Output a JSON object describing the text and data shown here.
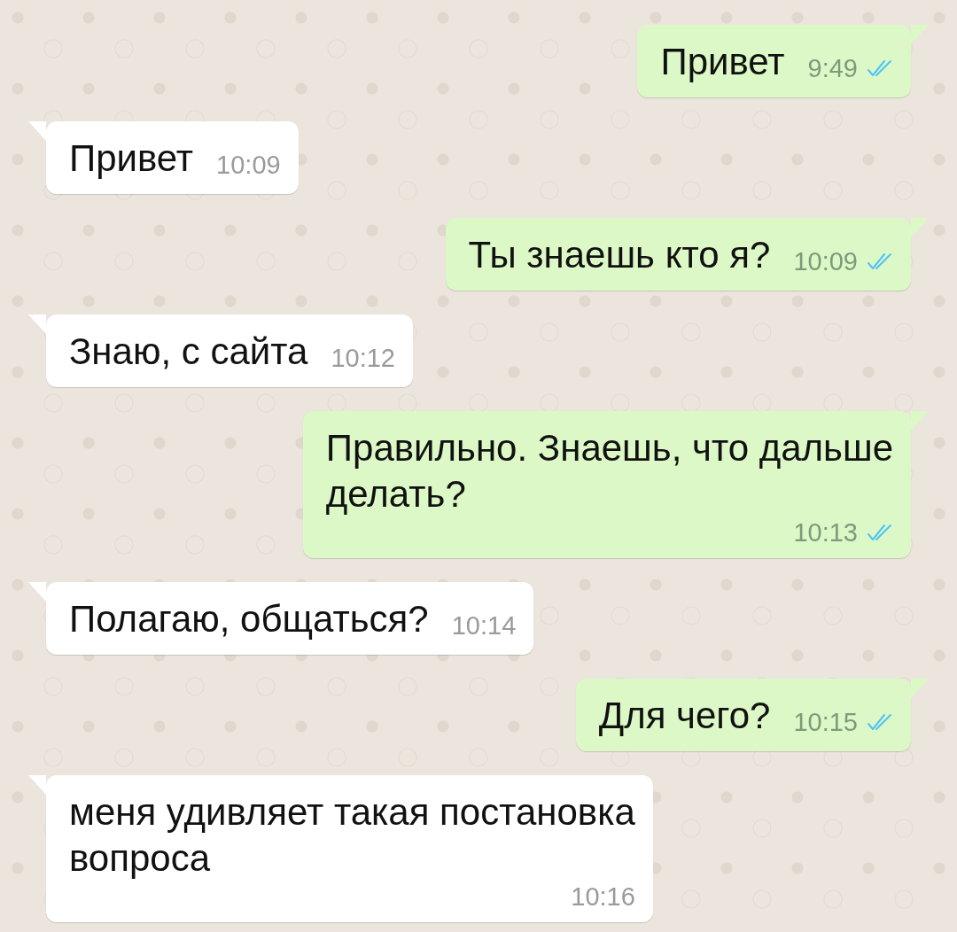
{
  "messages": [
    {
      "kind": "out",
      "lines": [
        "Привет"
      ],
      "time": "9:49",
      "read": true
    },
    {
      "kind": "in",
      "lines": [
        "Привет"
      ],
      "time": "10:09"
    },
    {
      "kind": "out",
      "lines": [
        "Ты знаешь кто я?"
      ],
      "time": "10:09",
      "read": true
    },
    {
      "kind": "in",
      "lines": [
        "Знаю, с сайта"
      ],
      "time": "10:12"
    },
    {
      "kind": "out",
      "lines": [
        "Правильно. Знаешь, что дальше",
        "делать?"
      ],
      "time": "10:13",
      "read": true
    },
    {
      "kind": "in",
      "lines": [
        "Полагаю, общаться?"
      ],
      "time": "10:14"
    },
    {
      "kind": "out",
      "lines": [
        "Для чего?"
      ],
      "time": "10:15",
      "read": true
    },
    {
      "kind": "in",
      "lines": [
        "меня удивляет такая постановка",
        "вопроса"
      ],
      "time": "10:16"
    }
  ]
}
